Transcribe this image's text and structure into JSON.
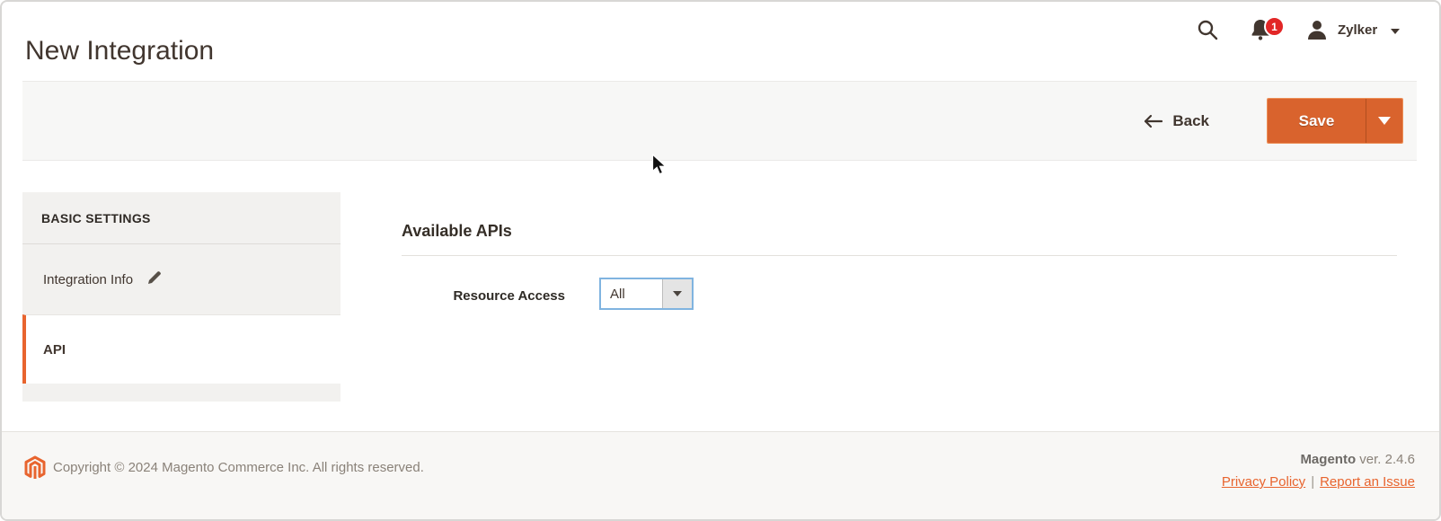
{
  "header": {
    "page_title": "New Integration",
    "search_icon": "search-icon",
    "notifications": {
      "icon": "bell-icon",
      "badge_count": "1"
    },
    "user": {
      "icon": "user-icon",
      "name": "Zylker",
      "caret_icon": "caret-down-icon"
    }
  },
  "toolbar": {
    "back_label": "Back",
    "back_icon": "arrow-left-icon",
    "save_label": "Save",
    "save_caret_icon": "caret-down-icon"
  },
  "sidebar": {
    "section_title": "BASIC SETTINGS",
    "items": [
      {
        "label": "Integration Info",
        "state": "default",
        "edit_icon": "pencil-icon"
      },
      {
        "label": "API",
        "state": "active"
      }
    ]
  },
  "content": {
    "section_title": "Available APIs",
    "form": {
      "resource_access": {
        "label": "Resource Access",
        "value": "All",
        "control": "select",
        "caret_icon": "caret-down-icon"
      }
    }
  },
  "footer": {
    "logo_icon": "magento-logo",
    "copyright": "Copyright © 2024 Magento Commerce Inc. All rights reserved.",
    "brand": "Magento",
    "version": "ver. 2.4.6",
    "privacy_link": "Privacy Policy",
    "separator": "|",
    "report_link": "Report an Issue"
  },
  "colors": {
    "accent_orange": "#e8642e",
    "save_button_bg": "#d9632d",
    "badge_red": "#e22626",
    "select_focus_border": "#80b4e0",
    "heading_text": "#41362f",
    "muted_text": "#8a8279",
    "panel_bg": "#f2f1ef",
    "toolbar_bg": "#f7f7f6",
    "footer_bg": "#f8f7f5"
  }
}
